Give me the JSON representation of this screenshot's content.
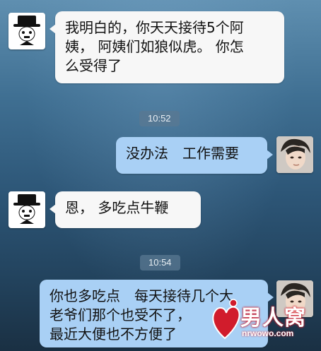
{
  "messages": [
    {
      "side": "left",
      "text": "我明白的，你天天接待5个阿姨，阿姨们如狼似虎。你怎么受得了"
    },
    {
      "timestamp": "10:52"
    },
    {
      "side": "right",
      "text": "没办法　工作需要"
    },
    {
      "side": "left",
      "text": "恩，多吃点牛鞭"
    },
    {
      "timestamp": "10:54"
    },
    {
      "side": "right",
      "text": "你也多吃点　每天接待几个大老爷们那个也受不了，最近大便也不方便了"
    }
  ],
  "chat": {
    "msg1": {
      "line1": "我明白的，你天天接待5个阿",
      "line2": "姨， 阿姨们如狼似虎。 你怎",
      "line3": "么受得了"
    },
    "time1": "10:52",
    "msg2": "没办法　工作需要",
    "msg3": "恩， 多吃点牛鞭",
    "time2": "10:54",
    "msg4": {
      "line1": "你也多吃点　每天接待几个大",
      "line2": "老爷们那个也受不了，",
      "line3": "最近大便也不方便了"
    }
  },
  "watermark": {
    "title": "男人窝",
    "url": "nrwowo.com"
  },
  "colors": {
    "incoming_bubble": "#f7f7f7",
    "outgoing_bubble": "#a9d0f5",
    "timestamp_bg": "#5a7891",
    "watermark_red": "#d11c2c"
  },
  "icons": {
    "left_avatar": "chaplin-avatar-icon",
    "right_avatar": "user-photo-avatar-icon"
  }
}
